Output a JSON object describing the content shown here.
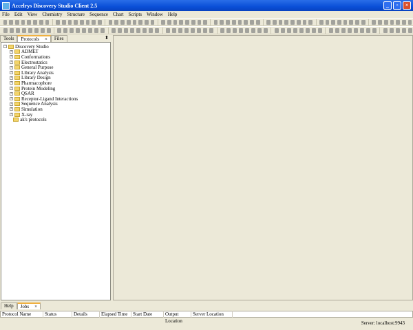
{
  "window": {
    "title": "Accelrys Discovery Studio Client 2.5"
  },
  "menu": [
    "File",
    "Edit",
    "View",
    "Chemistry",
    "Structure",
    "Sequence",
    "Chart",
    "Scripts",
    "Window",
    "Help"
  ],
  "left_tabs": [
    {
      "label": "Tools"
    },
    {
      "label": "Protocols",
      "close": "×"
    },
    {
      "label": "Files"
    }
  ],
  "tree": {
    "root": "Discovery Studio",
    "children": [
      "ADMET",
      "Conformations",
      "Electrostatics",
      "General Purpose",
      "Library Analysis",
      "Library Design",
      "Pharmacophore",
      "Protein Modeling",
      "QSAR",
      "Receptor-Ligand Interactions",
      "Sequence Analysis",
      "Simulation",
      "X-ray"
    ],
    "user": "ak's protocols"
  },
  "bottom_tabs": [
    {
      "label": "Help"
    },
    {
      "label": "Jobs",
      "close": "×"
    }
  ],
  "jobs_columns": [
    "Protocol Name",
    "Status",
    "Details",
    "Elapsed Time",
    "Start Date",
    "Output Location",
    "Server Location"
  ],
  "status": {
    "server": "Server: localhost:9943"
  }
}
